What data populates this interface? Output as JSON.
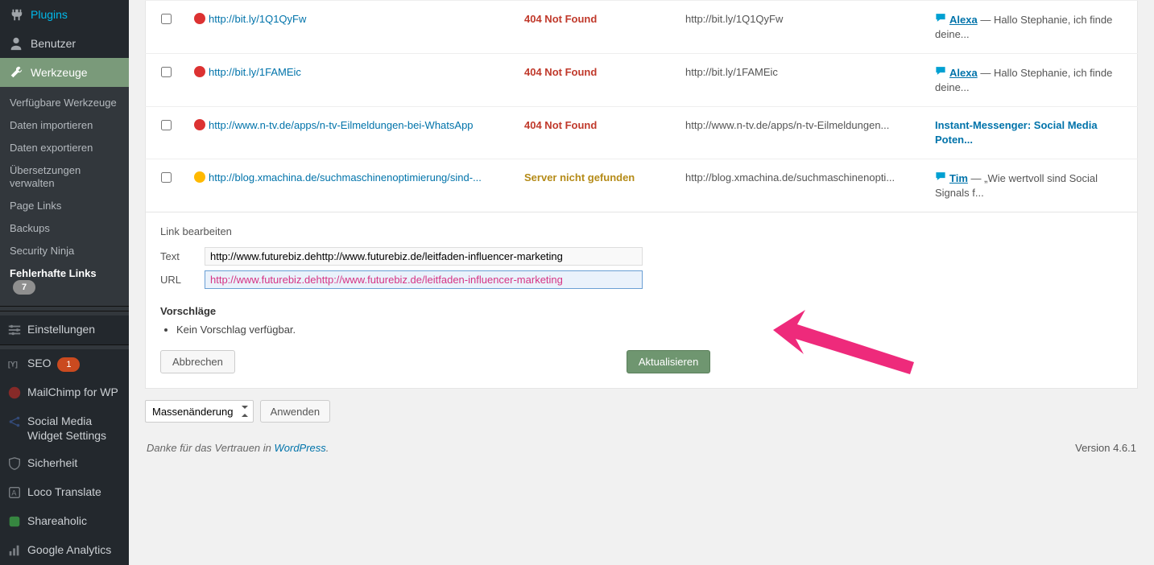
{
  "sidebar": {
    "items": [
      {
        "label": "Plugins",
        "icon": "plugins"
      },
      {
        "label": "Benutzer",
        "icon": "users"
      },
      {
        "label": "Werkzeuge",
        "icon": "tools",
        "active": true
      }
    ],
    "submenu": [
      "Verfügbare Werkzeuge",
      "Daten importieren",
      "Daten exportieren",
      "Übersetzungen verwalten",
      "Page Links",
      "Backups",
      "Security Ninja"
    ],
    "submenu_current": {
      "label": "Fehlerhafte Links",
      "count": "7"
    },
    "lower": [
      {
        "label": "Einstellungen",
        "icon": "settings"
      },
      {
        "label": "SEO",
        "icon": "seo",
        "badge": "1"
      },
      {
        "label": "MailChimp for WP",
        "icon": "mailchimp"
      },
      {
        "label": "Social Media Widget Settings",
        "icon": "share"
      },
      {
        "label": "Sicherheit",
        "icon": "shield"
      },
      {
        "label": "Loco Translate",
        "icon": "loco"
      },
      {
        "label": "Shareaholic",
        "icon": "shareaholic"
      },
      {
        "label": "Google Analytics",
        "icon": "analytics"
      }
    ]
  },
  "rows": [
    {
      "url": "http://bit.ly/1Q1QyFw",
      "status": "404 Not Found",
      "status_class": "404",
      "icon": "red",
      "linktext": "http://bit.ly/1Q1QyFw",
      "source_type": "comment",
      "source_author": "Alexa",
      "source_text": "— Hallo Stephanie, ich finde deine..."
    },
    {
      "url": "http://bit.ly/1FAMEic",
      "status": "404 Not Found",
      "status_class": "404",
      "icon": "red",
      "linktext": "http://bit.ly/1FAMEic",
      "source_type": "comment",
      "source_author": "Alexa",
      "source_text": "— Hallo Stephanie, ich finde deine..."
    },
    {
      "url": "http://www.n-tv.de/apps/n-tv-Eilmeldungen-bei-WhatsApp",
      "status": "404 Not Found",
      "status_class": "404",
      "icon": "red",
      "linktext": "http://www.n-tv.de/apps/n-tv-Eilmeldungen...",
      "source_type": "post",
      "source_title": "Instant-Messenger: Social Media Poten..."
    },
    {
      "url": "http://blog.xmachina.de/suchmaschinenoptimierung/sind-...",
      "status": "Server nicht gefunden",
      "status_class": "servernf",
      "icon": "warn",
      "linktext": "http://blog.xmachina.de/suchmaschinenopti...",
      "source_type": "comment",
      "source_author": "Tim",
      "source_text": "— „Wie wertvoll sind Social Signals f..."
    }
  ],
  "editor": {
    "heading": "Link bearbeiten",
    "text_label": "Text",
    "url_label": "URL",
    "text_value": "http://www.futurebiz.dehttp://www.futurebiz.de/leitfaden-influencer-marketing",
    "url_value": "http://www.futurebiz.dehttp://www.futurebiz.de/leitfaden-influencer-marketing",
    "suggestions_heading": "Vorschläge",
    "no_suggestion": "Kein Vorschlag verfügbar.",
    "cancel": "Abbrechen",
    "update": "Aktualisieren"
  },
  "bulk": {
    "select": "Massenänderung",
    "apply": "Anwenden"
  },
  "footer": {
    "thanks_prefix": "Danke für das Vertrauen in ",
    "wp": "WordPress",
    "version": "Version 4.6.1"
  }
}
